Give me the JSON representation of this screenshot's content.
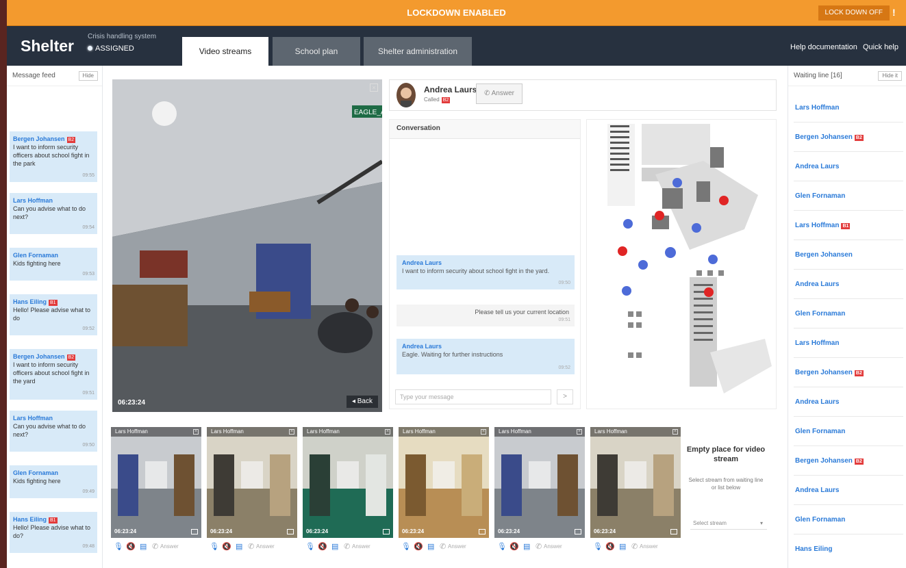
{
  "topbar": {
    "alert_text": "LOCKDOWN ENABLED",
    "session_label": "LOCK DOWN OFF",
    "session_icon": "alert-icon"
  },
  "header": {
    "logo": "Shelter",
    "system_name": "Crisis handling system",
    "status": "ASSIGNED",
    "tabs": [
      {
        "label": "Video streams",
        "active": true
      },
      {
        "label": "School plan"
      },
      {
        "label": "Shelter administration"
      }
    ],
    "help_link": "Help documentation",
    "quick_help": "Quick help"
  },
  "message_feed": {
    "title": "Message feed",
    "hide_label": "Hide",
    "messages": [
      {
        "name": "Bergen Johansen",
        "badge": "B2",
        "text": "I want to inform security officers about school fight in the park",
        "time": "09:55"
      },
      {
        "name": "Lars Hoffman",
        "badge": "",
        "text": "Can you advise what to do next?",
        "time": "09:54"
      },
      {
        "name": "Glen Fornaman",
        "badge": "",
        "text": "Kids fighting here",
        "time": "09:53"
      },
      {
        "name": "Hans Eiling",
        "badge": "B1",
        "text": "Hello! Please advise what to do",
        "time": "09:52"
      },
      {
        "name": "Bergen Johansen",
        "badge": "B2",
        "text": "I want to inform security officers about school fight in the yard",
        "time": "09:51"
      },
      {
        "name": "Lars Hoffman",
        "badge": "",
        "text": "Can you advise what to do next?",
        "time": "09:50"
      },
      {
        "name": "Glen Fornaman",
        "badge": "",
        "text": "Kids fighting here",
        "time": "09:49"
      },
      {
        "name": "Hans Eiling",
        "badge": "B1",
        "text": "Hello! Please advise what to do?",
        "time": "09:48"
      }
    ]
  },
  "main_video": {
    "sign_text": "EAGLE_AV",
    "time": "06:23:24",
    "back_label": "Back"
  },
  "call": {
    "name": "Andrea Laurs",
    "called_label": "Called",
    "called_badge": "B2",
    "answer_label": "Answer"
  },
  "conversation": {
    "title": "Conversation",
    "messages": [
      {
        "name": "Andrea Laurs",
        "text": "I want to inform security about school fight in the yard.",
        "time": "09:50",
        "dir": "in"
      },
      {
        "name": "",
        "text": "Please tell us your current location",
        "time": "09:51",
        "dir": "out"
      },
      {
        "name": "Andrea Laurs",
        "text": "Eagle. Waiting for further instructions",
        "time": "09:52",
        "dir": "in"
      }
    ],
    "input_placeholder": "Type your message",
    "send_label": ">"
  },
  "waiting_line": {
    "title": "Waiting line [16]",
    "hide_label": "Hide it",
    "items": [
      {
        "name": "Lars Hoffman",
        "badge": ""
      },
      {
        "name": "Bergen Johansen",
        "badge": "B2"
      },
      {
        "name": "Andrea Laurs",
        "badge": ""
      },
      {
        "name": "Glen Fornaman",
        "badge": ""
      },
      {
        "name": "Lars Hoffman",
        "badge": "B1"
      },
      {
        "name": "Bergen Johansen",
        "badge": ""
      },
      {
        "name": "Andrea Laurs",
        "badge": ""
      },
      {
        "name": "Glen Fornaman",
        "badge": ""
      },
      {
        "name": "Lars Hoffman",
        "badge": ""
      },
      {
        "name": "Bergen Johansen",
        "badge": "B2"
      },
      {
        "name": "Andrea Laurs",
        "badge": ""
      },
      {
        "name": "Glen Fornaman",
        "badge": ""
      },
      {
        "name": "Bergen Johansen",
        "badge": "B2"
      },
      {
        "name": "Andrea Laurs",
        "badge": ""
      },
      {
        "name": "Glen Fornaman",
        "badge": ""
      },
      {
        "name": "Hans Eiling",
        "badge": ""
      }
    ]
  },
  "streams": [
    {
      "name": "Lars Hoffman",
      "time": "06:23:24",
      "scene": "atrium",
      "answer": "Answer"
    },
    {
      "name": "Lars Hoffman",
      "time": "06:23:24",
      "scene": "corridor",
      "answer": "Answer"
    },
    {
      "name": "Lars Hoffman",
      "time": "06:23:24",
      "scene": "lockers",
      "answer": "Answer"
    },
    {
      "name": "Lars Hoffman",
      "time": "06:23:24",
      "scene": "library",
      "answer": "Answer"
    },
    {
      "name": "Lars Hoffman",
      "time": "06:23:24",
      "scene": "atrium",
      "answer": "Answer"
    },
    {
      "name": "Lars Hoffman",
      "time": "06:23:24",
      "scene": "corridor",
      "answer": "Answer"
    }
  ],
  "empty_slot": {
    "title": "Empty place for video stream",
    "subtitle": "Select stream from waiting line or list below",
    "select_placeholder": "Select stream"
  },
  "colors": {
    "accent": "#f39a2e",
    "header": "#27313f",
    "message_bg": "#d8eaf8",
    "link": "#2a7ad8",
    "badge": "#e23b3b"
  }
}
